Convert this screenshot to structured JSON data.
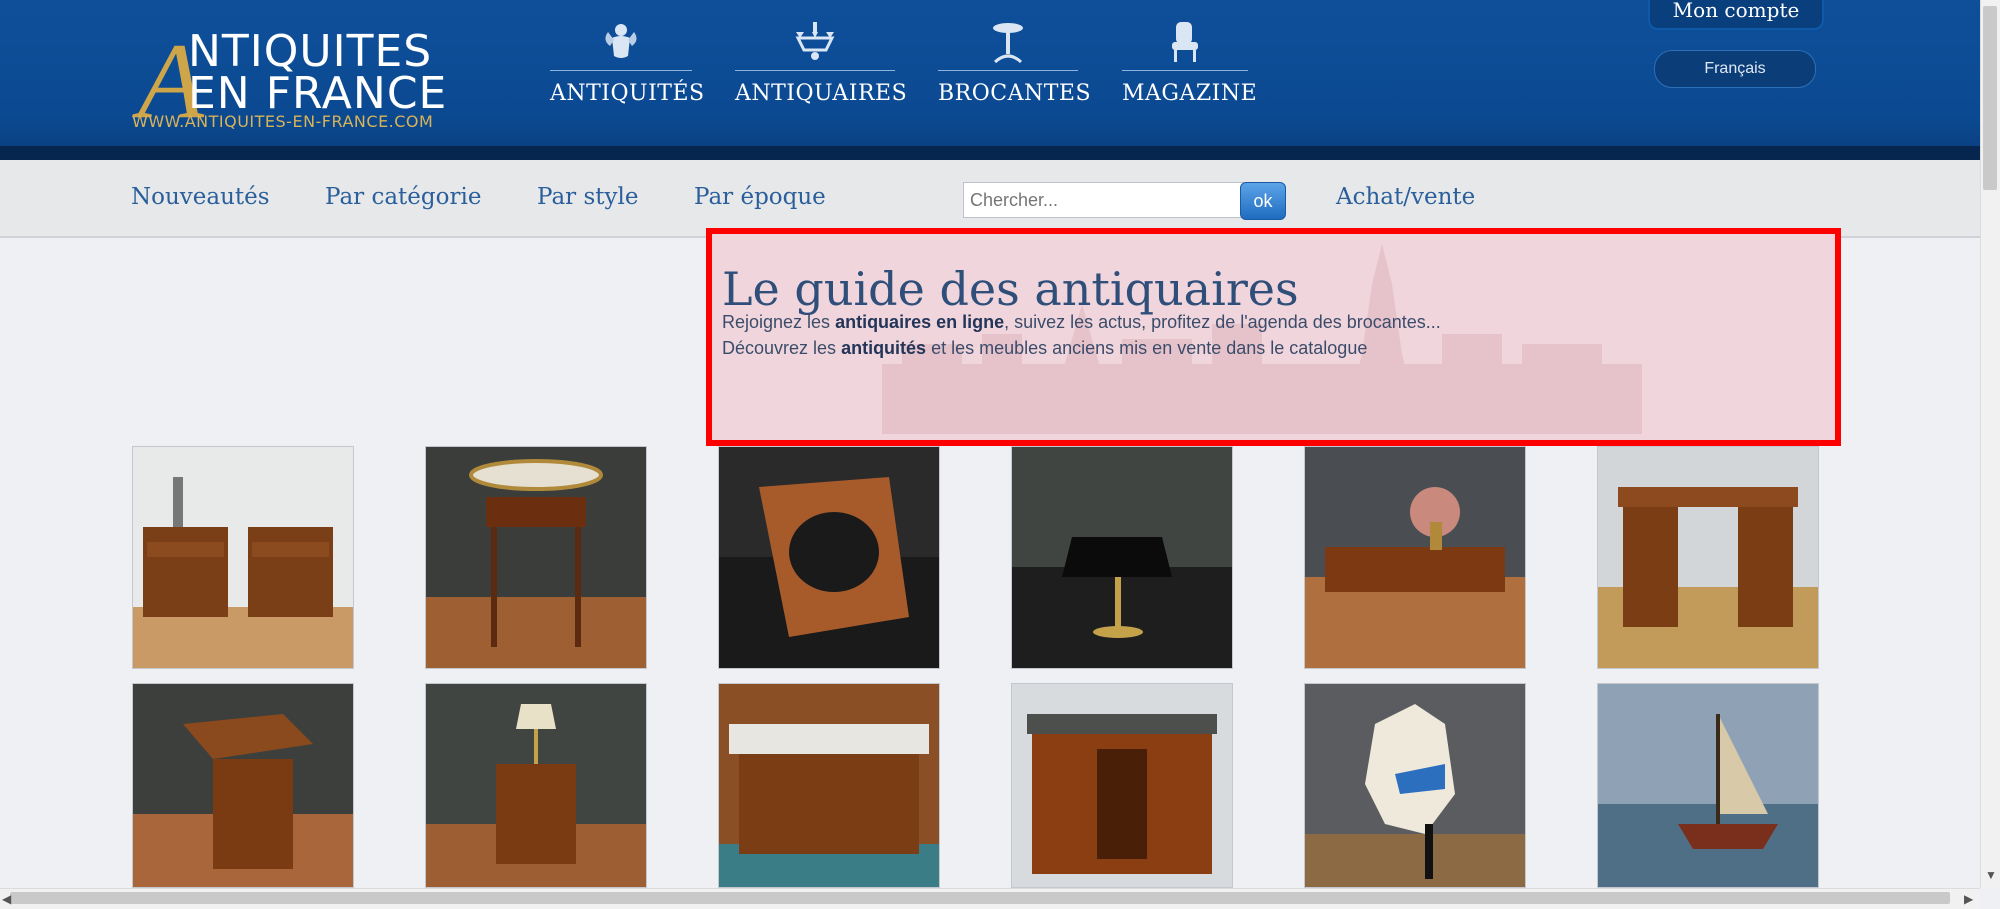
{
  "brand": {
    "logo_a": "A",
    "logo_line1": "NTIQUITES",
    "logo_line2": "EN FRANCE",
    "logo_url": "WWW.ANTIQUITES-EN-FRANCE.COM"
  },
  "topnav": [
    {
      "label": "ANTIQUITÉS",
      "icon": "cherub-icon"
    },
    {
      "label": "ANTIQUAIRES",
      "icon": "chandelier-icon"
    },
    {
      "label": "BROCANTES",
      "icon": "gueridon-table-icon"
    },
    {
      "label": "MAGAZINE",
      "icon": "armchair-icon"
    }
  ],
  "account": {
    "label": "Mon compte"
  },
  "language": {
    "label": "Français"
  },
  "subnav": {
    "items": [
      "Nouveautés",
      "Par catégorie",
      "Par style",
      "Par époque"
    ],
    "search_placeholder": "Chercher...",
    "ok_label": "ok",
    "extra": "Achat/vente"
  },
  "hero": {
    "title": "Le guide des antiquaires",
    "line1_pre": "Rejoignez les ",
    "line1_bold": "antiquaires en ligne",
    "line1_post": ", suivez les actus, profitez de l'agenda des brocantes...",
    "line2_pre": "Découvrez les ",
    "line2_bold": "antiquités",
    "line2_post": " et les meubles anciens mis en vente dans le catalogue"
  },
  "colors": {
    "header_blue": "#0f4f9a",
    "gold": "#cfa54a",
    "link_blue": "#2a5f9b",
    "highlight_red": "#ff0000"
  },
  "products": [
    {
      "name": "pair-of-bedside-tables"
    },
    {
      "name": "round-gueridon-table"
    },
    {
      "name": "wooden-bidet-frame"
    },
    {
      "name": "bouillotte-lamp"
    },
    {
      "name": "coffee-table-with-flowers"
    },
    {
      "name": "mahogany-desk"
    },
    {
      "name": "revolving-bookcase"
    },
    {
      "name": "small-chest-with-lamp"
    },
    {
      "name": "marble-washstand"
    },
    {
      "name": "art-deco-cabinet"
    },
    {
      "name": "carousel-horse"
    },
    {
      "name": "sailboat-painting"
    }
  ]
}
